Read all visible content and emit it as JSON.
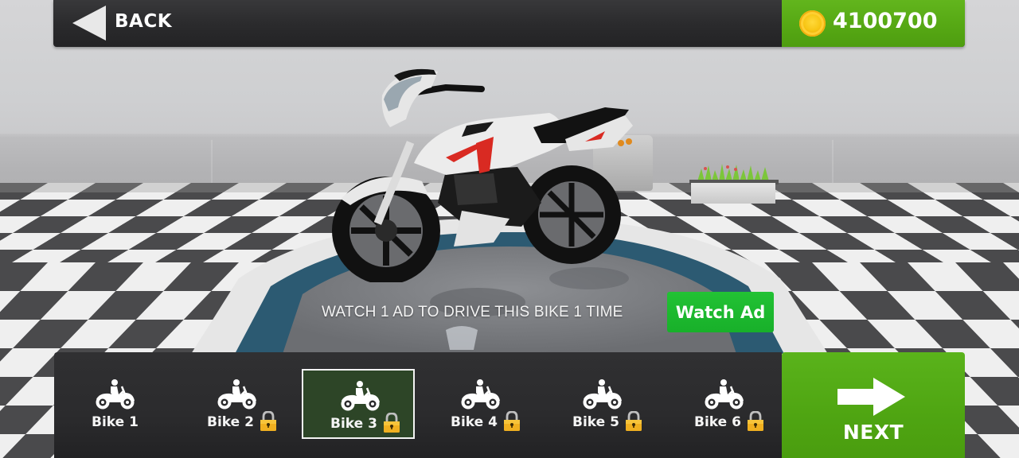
{
  "top_bar": {
    "back_label": "BACK",
    "back_icon": "left-triangle-arrow",
    "coin_icon": "gold-coin",
    "coins": "4100700"
  },
  "ad_offer": {
    "message": "WATCH 1 AD TO DRIVE THIS BIKE 1 TIME",
    "button_label": "Watch Ad"
  },
  "bike_selector": {
    "selected_index": 2,
    "items": [
      {
        "label": "Bike 1",
        "icon": "motorcycle-rider",
        "locked": false
      },
      {
        "label": "Bike 2",
        "icon": "motorcycle-rider",
        "locked": true
      },
      {
        "label": "Bike 3",
        "icon": "motorcycle-rider",
        "locked": true
      },
      {
        "label": "Bike 4",
        "icon": "motorcycle-rider",
        "locked": true
      },
      {
        "label": "Bike 5",
        "icon": "motorcycle-rider",
        "locked": true
      },
      {
        "label": "Bike 6",
        "icon": "motorcycle-rider",
        "locked": true
      }
    ]
  },
  "next_button": {
    "label": "NEXT",
    "icon": "right-arrow"
  },
  "colors": {
    "accent_green": "#56a814",
    "watch_ad_green": "#1db52e",
    "bar_dark": "#2b2b2d",
    "selected_bg": "#2d4527",
    "coin_gold": "#f7c514",
    "lock_gold": "#f0b020",
    "bike_red": "#d92a22"
  }
}
